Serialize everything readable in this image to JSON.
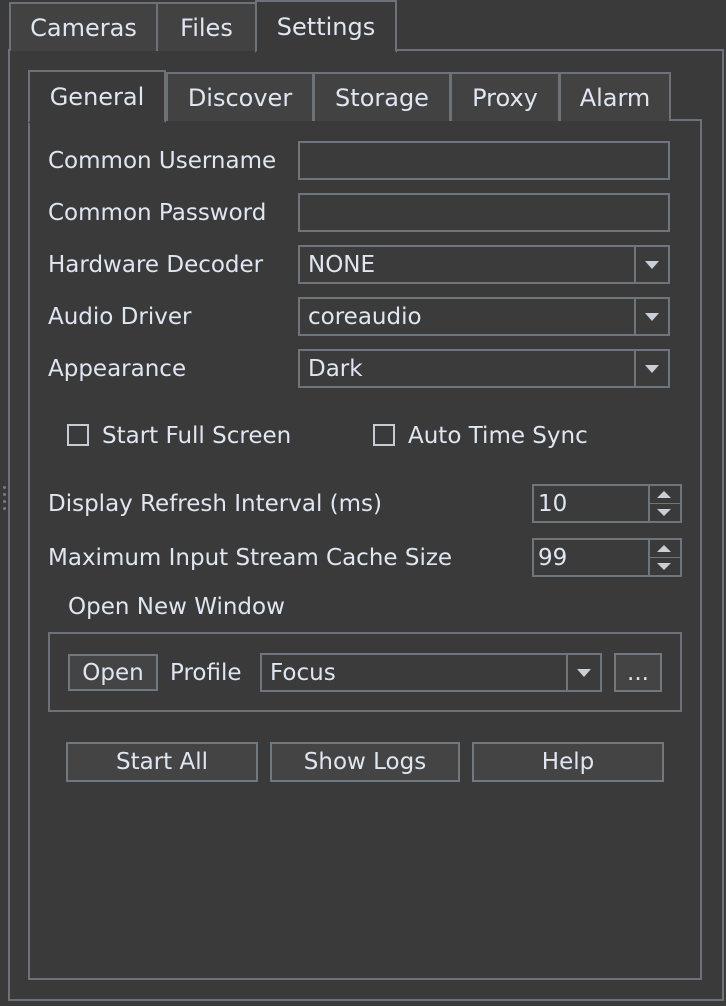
{
  "main_tabs": [
    {
      "label": "Cameras",
      "active": false
    },
    {
      "label": "Files",
      "active": false
    },
    {
      "label": "Settings",
      "active": true
    }
  ],
  "sub_tabs": [
    {
      "label": "General",
      "active": true
    },
    {
      "label": "Discover",
      "active": false
    },
    {
      "label": "Storage",
      "active": false
    },
    {
      "label": "Proxy",
      "active": false
    },
    {
      "label": "Alarm",
      "active": false
    }
  ],
  "general": {
    "common_username": {
      "label": "Common Username",
      "value": ""
    },
    "common_password": {
      "label": "Common Password",
      "value": ""
    },
    "hardware_decoder": {
      "label": "Hardware Decoder",
      "value": "NONE"
    },
    "audio_driver": {
      "label": "Audio Driver",
      "value": "coreaudio"
    },
    "appearance": {
      "label": "Appearance",
      "value": "Dark"
    },
    "start_full_screen": {
      "label": "Start Full Screen",
      "checked": false
    },
    "auto_time_sync": {
      "label": "Auto Time Sync",
      "checked": false
    },
    "display_refresh_interval": {
      "label": "Display Refresh Interval (ms)",
      "value": "10"
    },
    "max_cache_size": {
      "label": "Maximum Input Stream Cache Size",
      "value": "99"
    },
    "open_new_window": {
      "title": "Open New Window",
      "open_button": "Open",
      "profile_label": "Profile",
      "profile_value": "Focus",
      "more_button": "..."
    },
    "buttons": {
      "start_all": "Start All",
      "show_logs": "Show Logs",
      "help": "Help"
    }
  },
  "icons": {
    "dropdown": "chevron-down-icon",
    "spin_up": "spin-up-icon",
    "spin_down": "spin-down-icon"
  },
  "colors": {
    "background": "#3a3a3a",
    "border": "#6c7278",
    "text": "#dfe6f1"
  }
}
